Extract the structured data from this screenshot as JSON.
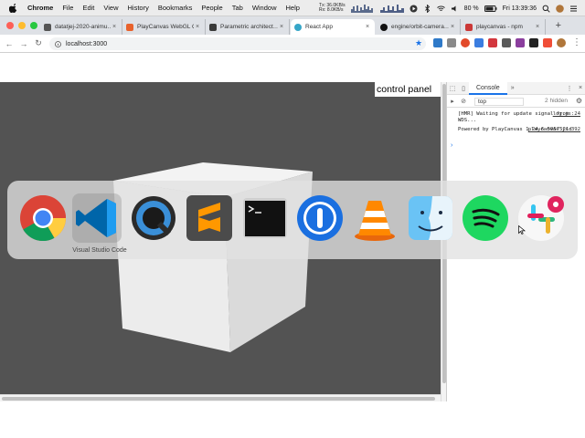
{
  "menubar": {
    "app_name": "Chrome",
    "items": [
      "File",
      "Edit",
      "View",
      "History",
      "Bookmarks",
      "People",
      "Tab",
      "Window",
      "Help"
    ],
    "net_tx": "Tx: 36.0KB/s",
    "net_rx": "Rx: 8.0KB/s",
    "battery": "80 %",
    "clock": "Fri 13:39:36"
  },
  "tabs": [
    {
      "title": "datatjej-2020-animu…",
      "favicon_color": "#555555"
    },
    {
      "title": "PlayCanvas WebGL G…",
      "favicon_color": "#e8622c"
    },
    {
      "title": "Parametric architect…",
      "favicon_color": "#3a3a3a"
    },
    {
      "title": "React App",
      "favicon_color": "#36a6c8"
    },
    {
      "title": "engine/orbit-camera…",
      "favicon_color": "#111111"
    },
    {
      "title": "playcanvas - npm",
      "favicon_color": "#cb3837"
    }
  ],
  "toolbar": {
    "url": "localhost:3000"
  },
  "page": {
    "control_panel_label": "control panel"
  },
  "devtools": {
    "tabs": [
      "Console"
    ],
    "context": "top",
    "hidden_count": "2 hidden",
    "logs": [
      {
        "text": "[HMR] Waiting for update signal from WDS...",
        "source": "log.js:24"
      },
      {
        "text": "Powered by PlayCanvas 1.24.6 5957521d",
        "source": "playcanvas.js:392"
      }
    ],
    "prompt": "›"
  },
  "dock": {
    "apps": [
      {
        "name": "Google Chrome",
        "icon": "chrome-icon"
      },
      {
        "name": "Visual Studio Code",
        "icon": "vscode-icon"
      },
      {
        "name": "QuickTime Player",
        "icon": "quicktime-icon"
      },
      {
        "name": "Sublime Text",
        "icon": "sublime-icon"
      },
      {
        "name": "Terminal",
        "icon": "terminal-icon"
      },
      {
        "name": "1Password",
        "icon": "onepassword-icon"
      },
      {
        "name": "VLC",
        "icon": "vlc-icon"
      },
      {
        "name": "Finder",
        "icon": "finder-icon"
      },
      {
        "name": "Spotify",
        "icon": "spotify-icon"
      },
      {
        "name": "Slack",
        "icon": "slack-icon"
      }
    ],
    "selected_label": "Visual Studio Code"
  }
}
